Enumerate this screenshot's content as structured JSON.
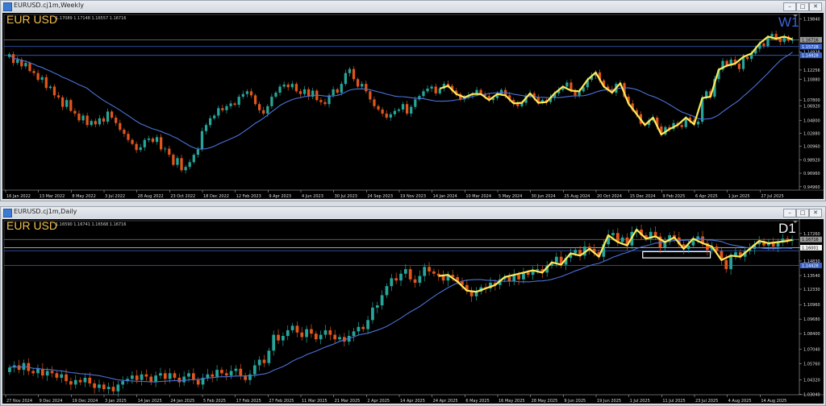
{
  "windows": {
    "weekly": {
      "title": "EURUSD.cj1m,Weekly",
      "ohlc": "1.17089 1.17148 1.16557 1.16716"
    },
    "daily": {
      "title": "EURUSD.cj1m,Daily",
      "ohlc": "1.16590 1.16741 1.16568 1.16716"
    }
  },
  "chart_data": [
    {
      "type": "line",
      "title": "EUR USD",
      "timeframe": "W1",
      "timeframe_color": "#3f63d6",
      "symbol_color": "#f2c14e",
      "up_color": "#26a69a",
      "down_color": "#e0561c",
      "ma_color": "#4a72d8",
      "zigzag_color": "#ffe95a",
      "ylim": [
        0.9446,
        1.2
      ],
      "y_ticks": [
        "1.19840",
        "1.14928",
        "1.12256",
        "1.10880",
        "1.07800",
        "1.06920",
        "1.04800",
        "1.02880",
        "1.00960",
        "0.98920",
        "0.96960",
        "0.94960"
      ],
      "x_ticks": [
        "16 Jan 2022",
        "13 Mar 2022",
        "8 May 2022",
        "3 Jul 2022",
        "28 Aug 2022",
        "23 Oct 2022",
        "18 Dec 2022",
        "12 Feb 2023",
        "9 Apr 2023",
        "4 Jun 2023",
        "30 Jul 2023",
        "24 Sep 2023",
        "19 Nov 2023",
        "14 Jan 2024",
        "10 Mar 2024",
        "5 May 2024",
        "30 Jun 2024",
        "25 Aug 2024",
        "20 Oct 2024",
        "15 Dec 2024",
        "9 Feb 2025",
        "6 Apr 2025",
        "1 Jun 2025",
        "27 Jul 2025"
      ],
      "price_tags": [
        {
          "value": 1.1673,
          "label": "1.16716",
          "color": "#9a9a9a"
        },
        {
          "value": 1.1573,
          "label": "1.15728",
          "color": "#3a62c8"
        },
        {
          "value": 1.1443,
          "label": "1.14428",
          "color": "#3a62c8"
        }
      ],
      "h_lines": [
        {
          "value": 1.1673,
          "color": "#7b7b7b"
        },
        {
          "value": 1.1573,
          "color": "#3a62c8"
        },
        {
          "value": 1.1443,
          "color": "#3a62c8"
        }
      ],
      "close": [
        1.146,
        1.133,
        1.138,
        1.128,
        1.133,
        1.121,
        1.118,
        1.108,
        1.112,
        1.096,
        1.098,
        1.085,
        1.082,
        1.068,
        1.078,
        1.062,
        1.058,
        1.048,
        1.055,
        1.041,
        1.047,
        1.042,
        1.051,
        1.046,
        1.061,
        1.052,
        1.044,
        1.034,
        1.028,
        1.019,
        1.013,
        1.004,
        1.008,
        1.019,
        1.021,
        1.016,
        1.023,
        1.005,
        1.006,
        0.997,
        0.982,
        0.992,
        0.974,
        0.979,
        0.986,
        0.997,
        1.005,
        1.032,
        1.041,
        1.051,
        1.055,
        1.066,
        1.063,
        1.069,
        1.073,
        1.071,
        1.083,
        1.087,
        1.091,
        1.085,
        1.072,
        1.063,
        1.058,
        1.069,
        1.083,
        1.089,
        1.098,
        1.101,
        1.097,
        1.102,
        1.091,
        1.087,
        1.094,
        1.083,
        1.092,
        1.078,
        1.075,
        1.072,
        1.085,
        1.094,
        1.089,
        1.102,
        1.118,
        1.124,
        1.109,
        1.098,
        1.102,
        1.091,
        1.079,
        1.069,
        1.064,
        1.058,
        1.052,
        1.057,
        1.062,
        1.064,
        1.072,
        1.058,
        1.068,
        1.079,
        1.084,
        1.091,
        1.095,
        1.098,
        1.088,
        1.095,
        1.102,
        1.099,
        1.092,
        1.087,
        1.079,
        1.082,
        1.085,
        1.087,
        1.093,
        1.087,
        1.084,
        1.078,
        1.081,
        1.087,
        1.093,
        1.085,
        1.078,
        1.073,
        1.069,
        1.074,
        1.084,
        1.088,
        1.082,
        1.074,
        1.078,
        1.075,
        1.082,
        1.088,
        1.093,
        1.098,
        1.104,
        1.092,
        1.085,
        1.091,
        1.097,
        1.108,
        1.114,
        1.119,
        1.107,
        1.098,
        1.094,
        1.089,
        1.102,
        1.103,
        1.083,
        1.073,
        1.063,
        1.057,
        1.043,
        1.041,
        1.048,
        1.052,
        1.039,
        1.027,
        1.038,
        1.035,
        1.044,
        1.041,
        1.038,
        1.052,
        1.048,
        1.042,
        1.046,
        1.081,
        1.091,
        1.083,
        1.109,
        1.123,
        1.136,
        1.129,
        1.138,
        1.132,
        1.124,
        1.142,
        1.139,
        1.147,
        1.154,
        1.162,
        1.158,
        1.172,
        1.176,
        1.169,
        1.164,
        1.172,
        1.166,
        1.168
      ]
    },
    {
      "type": "line",
      "title": "EUR USD",
      "timeframe": "D1",
      "timeframe_color": "#f2f2f2",
      "symbol_color": "#f2c14e",
      "up_color": "#26a69a",
      "down_color": "#e0561c",
      "ma_color": "#4a72d8",
      "zigzag_color": "#ffe95a",
      "ylim": [
        1.03,
        1.181
      ],
      "y_ticks": [
        "1.17260",
        "1.16001",
        "1.14830",
        "1.13540",
        "1.12330",
        "1.10960",
        "1.09680",
        "1.08400",
        "1.07040",
        "1.05760",
        "1.04320",
        "1.03040"
      ],
      "x_ticks": [
        "27 Nov 2024",
        "9 Dec 2024",
        "19 Dec 2024",
        "3 Jan 2025",
        "14 Jan 2025",
        "24 Jan 2025",
        "5 Feb 2025",
        "17 Feb 2025",
        "27 Feb 2025",
        "11 Mar 2025",
        "21 Mar 2025",
        "2 Apr 2025",
        "14 Apr 2025",
        "24 Apr 2025",
        "6 May 2025",
        "16 May 2025",
        "28 May 2025",
        "9 Jun 2025",
        "19 Jun 2025",
        "1 Jul 2025",
        "11 Jul 2025",
        "23 Jul 2025",
        "4 Aug 2025",
        "14 Aug 2025"
      ],
      "price_tags": [
        {
          "value": 1.1673,
          "label": "1.16716",
          "color": "#9a9a9a"
        },
        {
          "value": 1.16,
          "label": "1.16001",
          "color": "#f2f2f2"
        },
        {
          "value": 1.1443,
          "label": "1.14428",
          "color": "#3a62c8"
        }
      ],
      "h_lines": [
        {
          "value": 1.1673,
          "color": "#7b7b7b"
        },
        {
          "value": 1.16,
          "color": "#d8d8d8"
        },
        {
          "value": 1.1573,
          "color": "#3a62c8"
        },
        {
          "value": 1.1443,
          "color": "#3a62c8"
        }
      ],
      "zone": {
        "from": 1.1565,
        "to": 1.151,
        "start_frac": 0.803,
        "end_frac": 0.888,
        "color": "#ffffff"
      },
      "close": [
        1.054,
        1.056,
        1.052,
        1.058,
        1.051,
        1.049,
        1.053,
        1.047,
        1.051,
        1.049,
        1.045,
        1.048,
        1.042,
        1.039,
        1.043,
        1.041,
        1.045,
        1.04,
        1.036,
        1.039,
        1.035,
        1.037,
        1.033,
        1.039,
        1.042,
        1.044,
        1.047,
        1.043,
        1.048,
        1.046,
        1.041,
        1.047,
        1.049,
        1.044,
        1.049,
        1.045,
        1.041,
        1.046,
        1.049,
        1.043,
        1.039,
        1.045,
        1.048,
        1.046,
        1.052,
        1.049,
        1.047,
        1.051,
        1.053,
        1.047,
        1.043,
        1.048,
        1.056,
        1.061,
        1.058,
        1.069,
        1.083,
        1.078,
        1.082,
        1.087,
        1.091,
        1.085,
        1.081,
        1.088,
        1.084,
        1.079,
        1.083,
        1.087,
        1.083,
        1.079,
        1.081,
        1.077,
        1.082,
        1.086,
        1.09,
        1.088,
        1.096,
        1.107,
        1.109,
        1.118,
        1.126,
        1.133,
        1.131,
        1.137,
        1.141,
        1.132,
        1.129,
        1.135,
        1.143,
        1.139,
        1.137,
        1.135,
        1.131,
        1.136,
        1.134,
        1.13,
        1.127,
        1.122,
        1.117,
        1.121,
        1.125,
        1.124,
        1.129,
        1.127,
        1.132,
        1.134,
        1.13,
        1.136,
        1.132,
        1.138,
        1.136,
        1.14,
        1.141,
        1.138,
        1.144,
        1.147,
        1.152,
        1.145,
        1.151,
        1.155,
        1.158,
        1.153,
        1.161,
        1.159,
        1.156,
        1.152,
        1.163,
        1.171,
        1.173,
        1.165,
        1.169,
        1.162,
        1.174,
        1.176,
        1.171,
        1.168,
        1.174,
        1.17,
        1.16,
        1.165,
        1.171,
        1.169,
        1.163,
        1.159,
        1.162,
        1.168,
        1.17,
        1.164,
        1.158,
        1.161,
        1.157,
        1.149,
        1.141,
        1.153,
        1.156,
        1.152,
        1.157,
        1.159,
        1.163,
        1.166,
        1.162,
        1.164,
        1.161,
        1.165,
        1.168,
        1.166,
        1.167
      ]
    }
  ]
}
